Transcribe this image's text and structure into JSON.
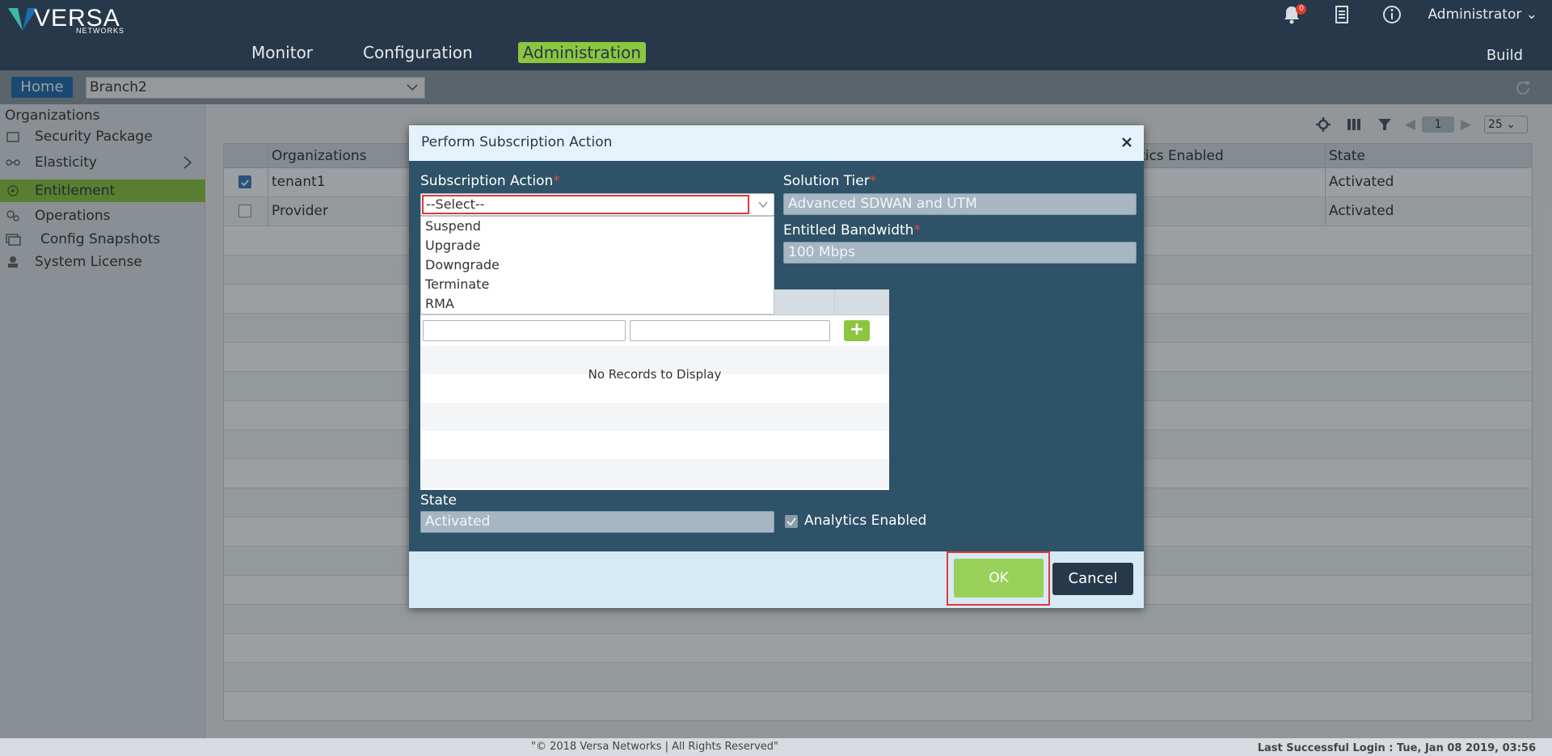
{
  "brand": {
    "name": "VERSA",
    "sub": "NETWORKS"
  },
  "header": {
    "nav": [
      "Monitor",
      "Configuration",
      "Administration"
    ],
    "active_nav": "Administration",
    "notification_count": "0",
    "user": "Administrator",
    "build_label": "Build"
  },
  "breadcrumb": {
    "home_label": "Home",
    "selected_org": "Branch2"
  },
  "sidebar": {
    "title": "Organizations",
    "items": [
      {
        "label": "Security Package",
        "icon": "package-icon"
      },
      {
        "label": "Elasticity",
        "icon": "elasticity-icon"
      },
      {
        "label": "Entitlement",
        "icon": "entitlement-icon"
      },
      {
        "label": "Operations",
        "icon": "operations-icon"
      },
      {
        "label": "Config Snapshots",
        "icon": "snapshot-icon"
      },
      {
        "label": "System License",
        "icon": "license-icon"
      }
    ],
    "active_item": "Entitlement"
  },
  "grid": {
    "columns": [
      "Organizations",
      "ytics Enabled",
      "State"
    ],
    "rows": [
      {
        "org": "tenant1",
        "state": "Activated",
        "checked": true
      },
      {
        "org": "Provider",
        "state": "Activated",
        "checked": false
      }
    ],
    "page": "1",
    "page_size": "25"
  },
  "dialog": {
    "title": "Perform Subscription Action",
    "subscription_action_label": "Subscription Action",
    "subscription_action_value": "--Select--",
    "options": [
      "Suspend",
      "Upgrade",
      "Downgrade",
      "Terminate",
      "RMA"
    ],
    "solution_tier_label": "Solution Tier",
    "solution_tier_value": "Advanced SDWAN and UTM",
    "bandwidth_label": "Entitled Bandwidth",
    "bandwidth_value": "100 Mbps",
    "no_records": "No Records to Display",
    "state_label": "State",
    "state_value": "Activated",
    "analytics_label": "Analytics Enabled",
    "analytics_checked": true,
    "ok_label": "OK",
    "cancel_label": "Cancel",
    "required_mark": "*"
  },
  "footer": {
    "copyright": "\"© 2018 Versa Networks | All Rights Reserved\"",
    "last_login": "Last Successful Login : Tue, Jan 08 2019, 03:56"
  },
  "colors": {
    "header_bg": "#27384a",
    "accent_green": "#8cc63f",
    "dialog_body": "#2e5267",
    "highlight_red": "#e03a3a"
  }
}
